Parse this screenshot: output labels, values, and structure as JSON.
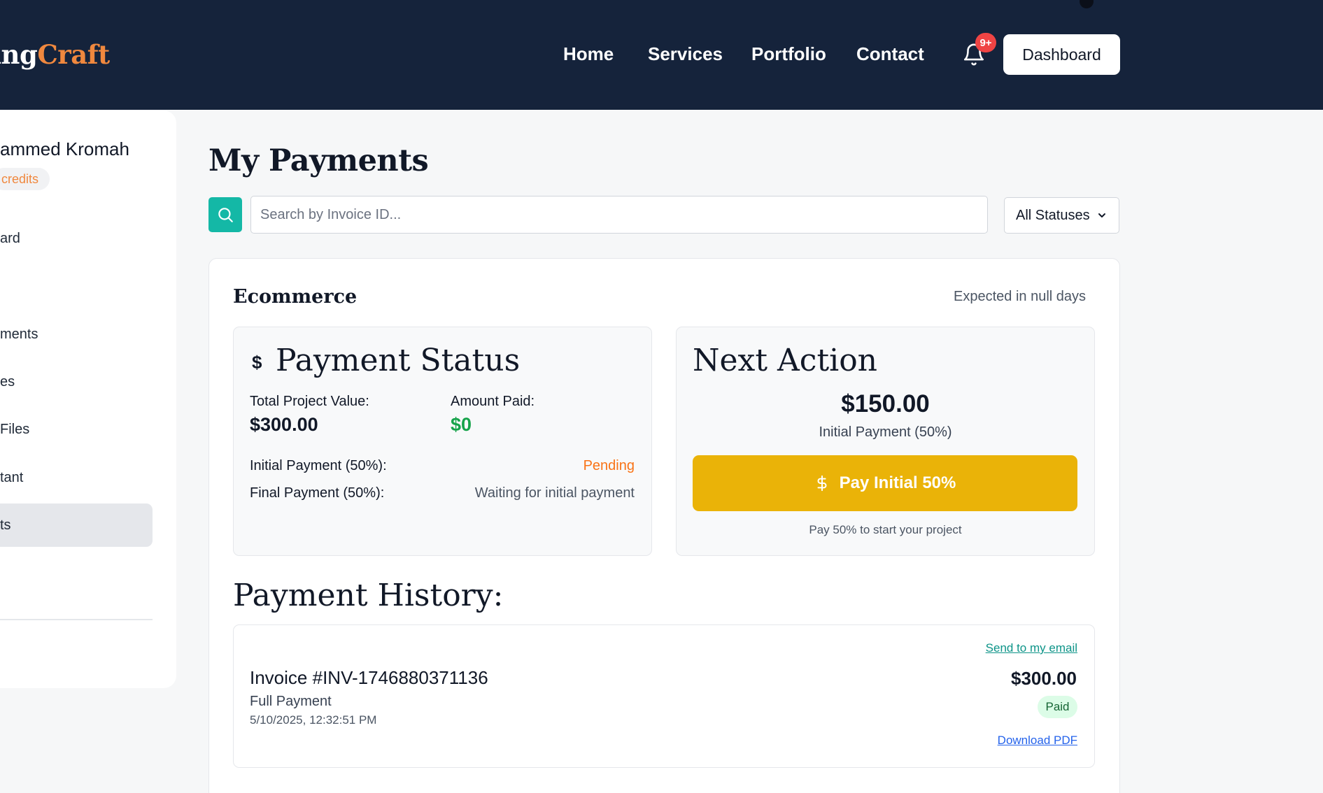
{
  "header": {
    "logo_prefix": "ing",
    "logo_accent": "Craft",
    "nav": [
      "Home",
      "Services",
      "Portfolio",
      "Contact"
    ],
    "notification_badge": "9+",
    "dashboard_label": "Dashboard"
  },
  "sidebar": {
    "user_name": "ammed Kromah",
    "credits_label": "credits",
    "items": [
      "ard",
      "ments",
      "es",
      "Files",
      "tant",
      "ts"
    ]
  },
  "main": {
    "title": "My Payments",
    "search_placeholder": "Search by Invoice ID...",
    "status_filter": "All Statuses"
  },
  "project": {
    "name": "Ecommerce",
    "expected": "Expected in null days",
    "payment_status": {
      "title": "Payment Status",
      "total_label": "Total Project Value:",
      "total_value": "$300.00",
      "paid_label": "Amount Paid:",
      "paid_value": "$0",
      "initial_label": "Initial Payment (50%):",
      "initial_status": "Pending",
      "final_label": "Final Payment (50%):",
      "final_status": "Waiting for initial payment"
    },
    "next_action": {
      "title": "Next Action",
      "amount": "$150.00",
      "subtitle": "Initial Payment (50%)",
      "button_label": "Pay Initial 50%",
      "hint": "Pay 50% to start your project"
    },
    "history": {
      "title": "Payment History:",
      "invoices": [
        {
          "id": "Invoice #INV-1746880371136",
          "type": "Full Payment",
          "date": "5/10/2025, 12:32:51 PM",
          "amount": "$300.00",
          "status": "Paid",
          "email_link": "Send to my email",
          "download_link": "Download PDF"
        }
      ]
    }
  },
  "colors": {
    "header_bg": "#15233b",
    "accent_orange": "#f0883e",
    "teal": "#14b8a6",
    "pay_yellow": "#eab308",
    "success_green": "#16a34a"
  }
}
